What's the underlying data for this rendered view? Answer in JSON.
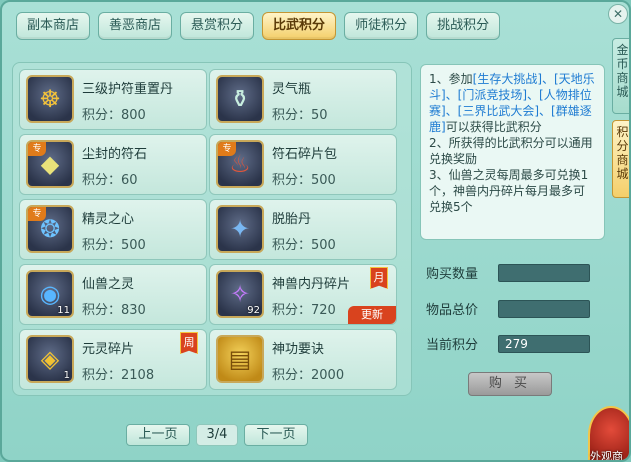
{
  "tabs": [
    {
      "label": "副本商店",
      "active": false
    },
    {
      "label": "善恶商店",
      "active": false
    },
    {
      "label": "悬赏积分",
      "active": false
    },
    {
      "label": "比武积分",
      "active": true
    },
    {
      "label": "师徒积分",
      "active": false
    },
    {
      "label": "挑战积分",
      "active": false
    }
  ],
  "price_prefix": "积分：",
  "items": [
    {
      "name": "三级护符重置丹",
      "price": "800",
      "icon": "talisman-pill-icon",
      "glyph": "☸",
      "count": "",
      "tag": "",
      "badge": ""
    },
    {
      "name": "灵气瓶",
      "price": "50",
      "icon": "spirit-bottle-icon",
      "glyph": "⚱",
      "count": "",
      "tag": "",
      "badge": ""
    },
    {
      "name": "尘封的符石",
      "price": "60",
      "icon": "sealed-rune-stone-icon",
      "glyph": "◆",
      "count": "",
      "tag": "专",
      "badge": ""
    },
    {
      "name": "符石碎片包",
      "price": "500",
      "icon": "rune-fragment-pack-icon",
      "glyph": "♨",
      "count": "",
      "tag": "专",
      "badge": ""
    },
    {
      "name": "精灵之心",
      "price": "500",
      "icon": "spirit-heart-icon",
      "glyph": "❂",
      "count": "",
      "tag": "专",
      "badge": ""
    },
    {
      "name": "脱胎丹",
      "price": "500",
      "icon": "rebirth-pill-icon",
      "glyph": "✦",
      "count": "",
      "tag": "",
      "badge": ""
    },
    {
      "name": "仙兽之灵",
      "price": "830",
      "icon": "divine-beast-soul-icon",
      "glyph": "◉",
      "count": "11",
      "tag": "",
      "badge": ""
    },
    {
      "name": "神兽内丹碎片",
      "price": "720",
      "icon": "beast-core-fragment-icon",
      "glyph": "✧",
      "count": "92",
      "tag": "",
      "badge": "月",
      "badge_new": "更新"
    },
    {
      "name": "元灵碎片",
      "price": "2108",
      "icon": "yuanling-fragment-icon",
      "glyph": "◈",
      "count": "1",
      "tag": "",
      "badge": "周"
    },
    {
      "name": "神功要诀",
      "price": "2000",
      "icon": "skill-manual-icon",
      "glyph": "▤",
      "count": "",
      "tag": "",
      "badge": ""
    }
  ],
  "pager": {
    "prev": "上一页",
    "page": "3/4",
    "next": "下一页"
  },
  "description": {
    "line1_pre": "1、参加",
    "line1_links": "[生存大挑战]、[天地乐斗]、[门派竞技场]、[人物排位赛]、[三界比武大会]、[群雄逐鹿]",
    "line1_post": "可以获得比武积分",
    "line2": "2、所获得的比武积分可以通用兑换奖励",
    "line3": "3、仙兽之灵每周最多可兑换1个，神兽内丹碎片每月最多可兑换5个"
  },
  "buy_quantity_label": "购买数量",
  "total_price_label": "物品总价",
  "current_points_label": "当前积分",
  "current_points_value": "279",
  "buy_button": "购 买",
  "side_tabs": [
    "金币商城",
    "积分商城"
  ],
  "corner_text": "外观商"
}
